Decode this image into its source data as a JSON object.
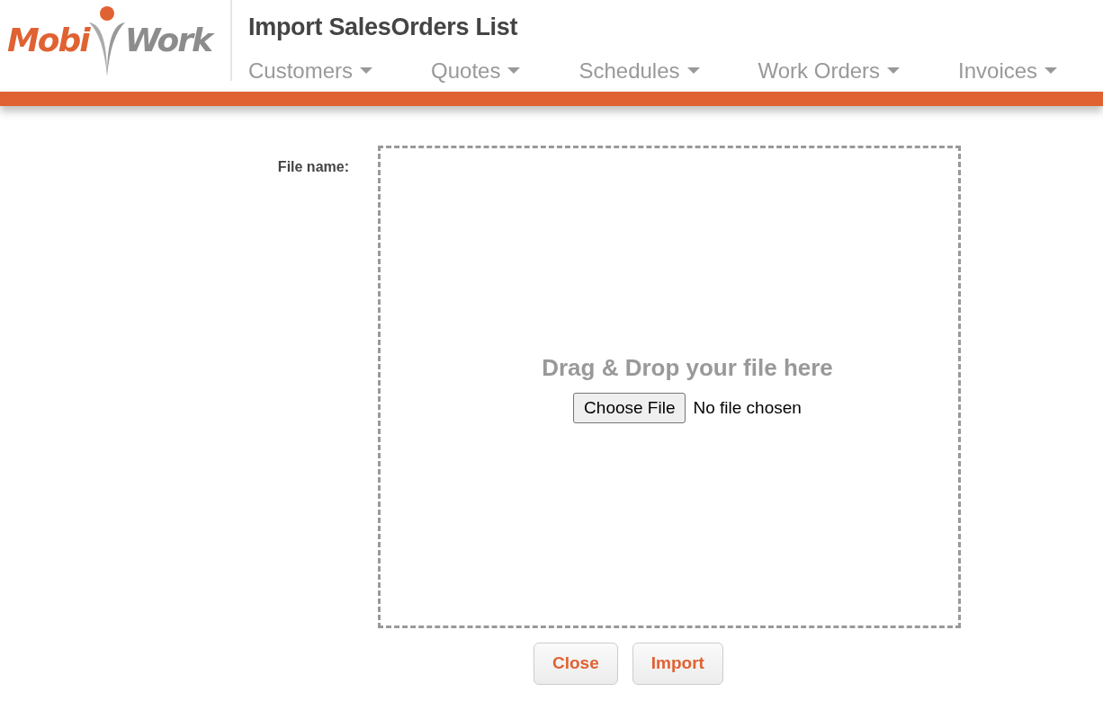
{
  "logo": {
    "left_text": "Mobi",
    "right_text": "Work"
  },
  "page_title": "Import SalesOrders List",
  "nav": [
    {
      "label": "Customers"
    },
    {
      "label": "Quotes"
    },
    {
      "label": "Schedules"
    },
    {
      "label": "Work Orders"
    },
    {
      "label": "Invoices"
    }
  ],
  "form": {
    "label": "File name:",
    "dropzone_text": "Drag & Drop your file here",
    "choose_button": "Choose File",
    "file_status": "No file chosen"
  },
  "buttons": [
    "Close",
    "Import"
  ]
}
